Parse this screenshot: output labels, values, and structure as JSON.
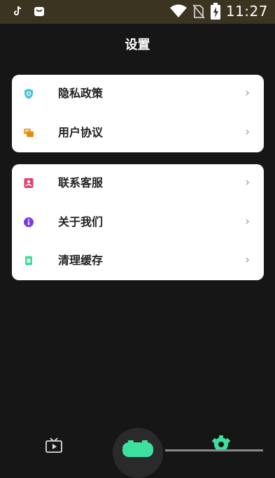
{
  "status_bar": {
    "time": "11:27",
    "icons": [
      "tiktok-icon",
      "notification-bag-icon",
      "wifi-icon",
      "no-sim-icon",
      "battery-charging-icon"
    ]
  },
  "page": {
    "title": "设置"
  },
  "group1": {
    "items": [
      {
        "label": "隐私政策",
        "icon": "shield-icon",
        "icon_color": "#4fc3d9"
      },
      {
        "label": "用户协议",
        "icon": "chat-bubble-icon",
        "icon_color": "#f2a33a"
      }
    ]
  },
  "group2": {
    "items": [
      {
        "label": "联系客服",
        "icon": "contact-card-icon",
        "icon_color": "#e0446a"
      },
      {
        "label": "关于我们",
        "icon": "info-icon",
        "icon_color": "#7b3fe0"
      },
      {
        "label": "清理缓存",
        "icon": "clean-cache-icon",
        "icon_color": "#3ddc9a"
      }
    ]
  },
  "chevron": "›",
  "tab_bar": {
    "tabs": [
      {
        "icon": "tv-play-icon"
      },
      {
        "icon": "game-controller-icon",
        "accent": "#3ee0a0"
      },
      {
        "icon": "gear-icon",
        "accent": "#3ee0a0"
      }
    ]
  }
}
